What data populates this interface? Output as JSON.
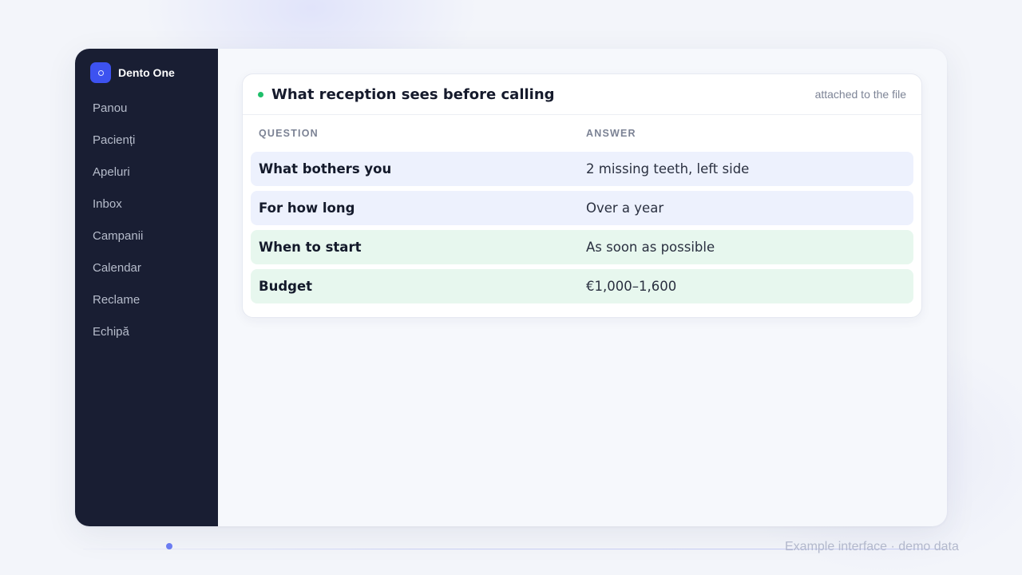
{
  "brand": {
    "name": "Dento One"
  },
  "sidebar": {
    "items": [
      {
        "label": "Panou"
      },
      {
        "label": "Pacienți"
      },
      {
        "label": "Apeluri"
      },
      {
        "label": "Inbox"
      },
      {
        "label": "Campanii"
      },
      {
        "label": "Calendar"
      },
      {
        "label": "Reclame"
      },
      {
        "label": "Echipă"
      }
    ]
  },
  "card": {
    "title": "What reception sees before calling",
    "note": "attached to the file",
    "status_color": "#1fbf6a",
    "columns": {
      "question": "QUESTION",
      "answer": "ANSWER"
    },
    "rows": [
      {
        "question": "What bothers you",
        "answer": "2 missing teeth, left side",
        "tint": "blue"
      },
      {
        "question": "For how long",
        "answer": "Over a year",
        "tint": "blue"
      },
      {
        "question": "When to start",
        "answer": "As soon as possible",
        "tint": "green"
      },
      {
        "question": "Budget",
        "answer": "€1,000–1,600",
        "tint": "green"
      }
    ]
  },
  "footer": {
    "caption": "Example interface · demo data"
  },
  "colors": {
    "sidebar_bg": "#191e33",
    "brand_accent": "#3d52f0",
    "row_blue": "#edf1fd",
    "row_green": "#e7f7ee"
  }
}
